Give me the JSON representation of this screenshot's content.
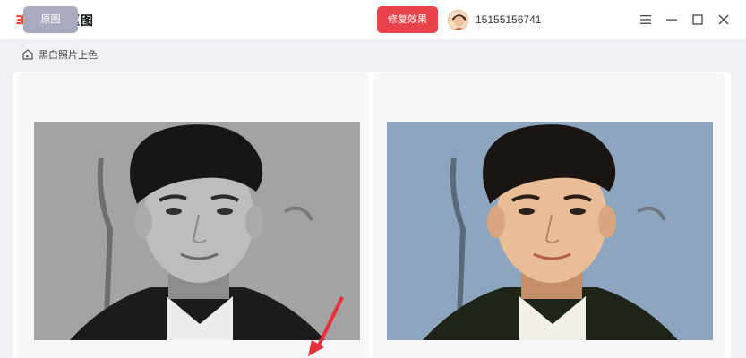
{
  "app": {
    "title": "一键抠图"
  },
  "user": {
    "id": "15155156741"
  },
  "window_controls": {
    "menu_icon": "menu-icon",
    "minimize_icon": "minimize-icon",
    "maximize_icon": "maximize-icon",
    "close_icon": "close-icon"
  },
  "breadcrumb": {
    "icon": "home-back-icon",
    "label": "黑白照片上色"
  },
  "original": {
    "tab_label": "原图"
  },
  "result": {
    "tab_label": "修复效果"
  },
  "colors": {
    "accent": "#e8434a",
    "neutral_tab": "#a8abbd",
    "background": "#eef0f5"
  }
}
